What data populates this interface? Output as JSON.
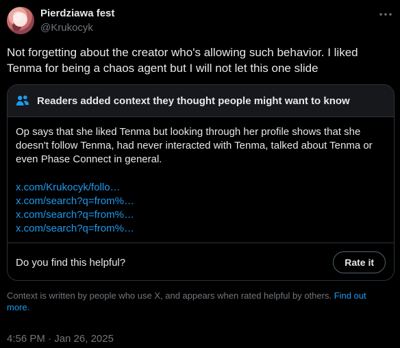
{
  "author": {
    "name": "Pierdziawa fest",
    "handle": "@Krukocyk",
    "avatar_icon": "avatar-image"
  },
  "menu_icon": "more-horizontal-icon",
  "tweet": {
    "text": "Not forgetting about the creator who's allowing such behavior. I liked Tenma for being a chaos agent but I will not let this one slide"
  },
  "community_note": {
    "header_icon": "people-icon",
    "title": "Readers added context they thought people might want to know",
    "body": "Op says that she liked Tenma but looking through her profile shows that she doesn't follow Tenma, had never interacted with Tenma, talked about Tenma or even Phase Connect in general.",
    "links": [
      "x.com/Krukocyk/follo…",
      "x.com/search?q=from%…",
      "x.com/search?q=from%…",
      "x.com/search?q=from%…"
    ],
    "helpful_question": "Do you find this helpful?",
    "rate_button": "Rate it"
  },
  "context_footer": {
    "text": "Context is written by people who use X, and appears when rated helpful by others.",
    "link": "Find out more."
  },
  "timestamp": "4:56 PM · Jan 26, 2025",
  "colors": {
    "background": "#000000",
    "text": "#e7e9ea",
    "secondary": "#71767b",
    "link": "#1d9bf0",
    "border": "#2f3336"
  }
}
